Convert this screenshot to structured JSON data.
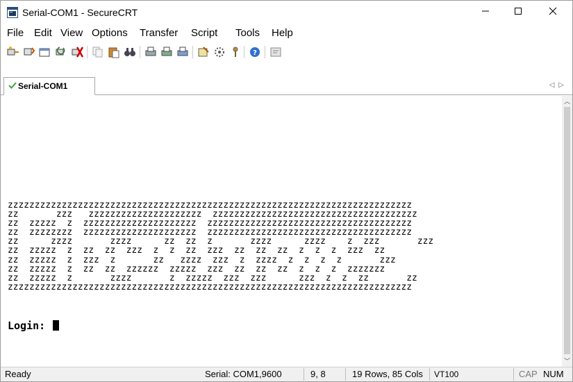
{
  "window": {
    "title": "Serial-COM1 - SecureCRT"
  },
  "menu": [
    "File",
    "Edit",
    "View",
    "Options",
    "Transfer",
    "Script",
    "Tools",
    "Help"
  ],
  "toolbar": {
    "icons": [
      "connect-icon",
      "quick-connect-icon",
      "connect-in-tab-icon",
      "reconnect-icon",
      "disconnect-icon",
      "copy-icon",
      "paste-icon",
      "find-icon",
      "print-icon",
      "print-selection-icon",
      "print-setup-icon",
      "session-options-icon",
      "global-options-icon",
      "keymap-icon",
      "help-icon",
      "sftp-icon"
    ]
  },
  "tab": {
    "label": "Serial-COM1"
  },
  "terminal": {
    "banner": [
      "zzzzzzzzzzzzzzzzzzzzzzzzzzzzzzzzzzzzzzzzzzzzzzzzzzzzzzzzzzzzzzzzzzzzzzzzzzz",
      "zz       zzz   zzzzzzzzzzzzzzzzzzzzz  zzzzzzzzzzzzzzzzzzzzzzzzzzzzzzzzzzzzzz",
      "zz  zzzzz  z  zzzzzzzzzzzzzzzzzzzzz  zzzzzzzzzzzzzzzzzzzzzzzzzzzzzzzzzzzzzz",
      "zz  zzzzzzzz  zzzzzzzzzzzzzzzzzzzzz  zzzzzzzzzzzzzzzzzzzzzzzzzzzzzzzzzzzzzz",
      "zz      zzzz       zzzz      zz  zz  z       zzzz      zzzz    z  zzz       zzz",
      "zz  zzzzz  z  zz  zz  zzz  z  z  zz  zzz  zz  zz  zz  z  z  z  zzz  zz",
      "zz  zzzzz  z  zzz  z       zz   zzzz  zzz  z  zzzz  z  z  z  z       zzz",
      "zz  zzzzz  z  zz  zz  zzzzzz  zzzzz  zzz  zz  zz  zz  z  z  z  zzzzzzz",
      "zz  zzzzz  z       zzzz       z  zzzzz  zzz  zzz      zzz  z  z  zz       zz",
      "zzzzzzzzzzzzzzzzzzzzzzzzzzzzzzzzzzzzzzzzzzzzzzzzzzzzzzzzzzzzzzzzzzzzzzzzzzz"
    ],
    "prompt": "Login: "
  },
  "statusbar": {
    "status": "Ready",
    "connection": "Serial: COM1,9600",
    "cursor_pos": "9,  8",
    "dimensions": "19 Rows, 85 Cols",
    "emulation": "VT100",
    "caps": "CAP",
    "num": "NUM"
  }
}
